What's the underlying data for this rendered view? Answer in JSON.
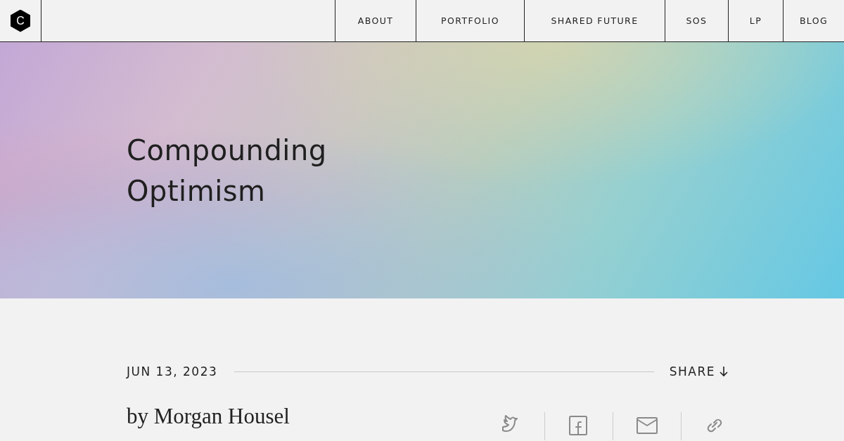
{
  "logo": "C",
  "nav": [
    {
      "label": "ABOUT"
    },
    {
      "label": "PORTFOLIO"
    },
    {
      "label": "SHARED FUTURE"
    },
    {
      "label": "SOS"
    },
    {
      "label": "LP"
    },
    {
      "label": "BLOG"
    }
  ],
  "hero": {
    "title_lines": [
      "Compounding",
      "Optimism"
    ]
  },
  "meta": {
    "date": "JUN 13, 2023",
    "share": "SHARE"
  },
  "author": "by Morgan Housel",
  "share_icons": [
    {
      "kind": "bird"
    },
    {
      "kind": "f"
    },
    {
      "kind": "mail"
    },
    {
      "kind": "link"
    }
  ]
}
